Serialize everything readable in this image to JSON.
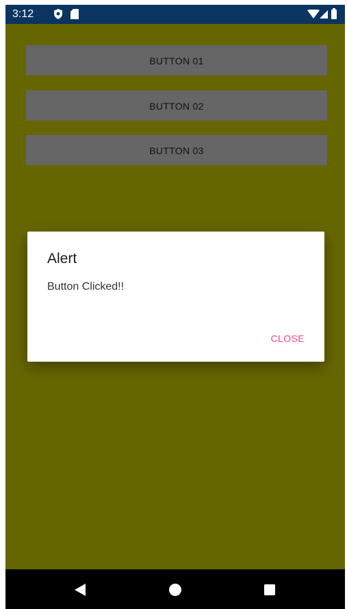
{
  "status_bar": {
    "time": "3:12",
    "icons": [
      "shield-icon",
      "sd-card-icon",
      "wifi-icon",
      "signal-icon",
      "battery-icon"
    ]
  },
  "buttons": [
    {
      "label": "BUTTON 01"
    },
    {
      "label": "BUTTON 02"
    },
    {
      "label": "BUTTON 03"
    }
  ],
  "dialog": {
    "title": "Alert",
    "message": "Button Clicked!!",
    "action_label": "CLOSE"
  },
  "nav_bar": {
    "icons": [
      "back-icon",
      "home-icon",
      "recents-icon"
    ]
  },
  "colors": {
    "status_bar": "#0b3560",
    "background": "#666600",
    "button": "#666666",
    "dialog_action": "#ff4081",
    "nav_bar": "#000000"
  }
}
